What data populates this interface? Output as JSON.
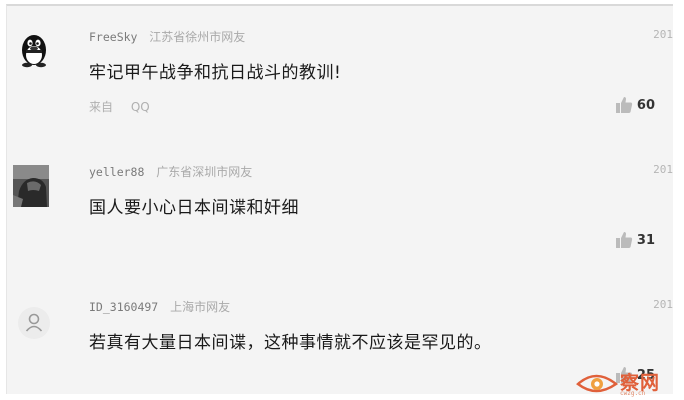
{
  "comments": [
    {
      "username": "FreeSky",
      "location": "江苏省徐州市网友",
      "date": "201",
      "text": "牢记甲午战争和抗日战斗的教训!",
      "source_label": "来自",
      "source_value": "QQ",
      "likes": "60",
      "avatar_icon": "qq-penguin-icon"
    },
    {
      "username": "yeller88",
      "location": "广东省深圳市网友",
      "date": "201",
      "text": "国人要小心日本间谍和奸细",
      "likes": "31",
      "avatar_icon": "user-photo-avatar"
    },
    {
      "username": "ID_3160497",
      "location": "上海市网友",
      "date": "201",
      "text": "若真有大量日本间谍，这种事情就不应该是罕见的。",
      "likes": "25",
      "avatar_icon": "default-user-icon"
    }
  ],
  "watermark": {
    "brand": "察网",
    "url": "cwzg.cn"
  },
  "colors": {
    "background": "#f4f4f4",
    "text": "#1a1a1a",
    "meta": "#a9a9a9",
    "watermark": "#e0603a"
  }
}
